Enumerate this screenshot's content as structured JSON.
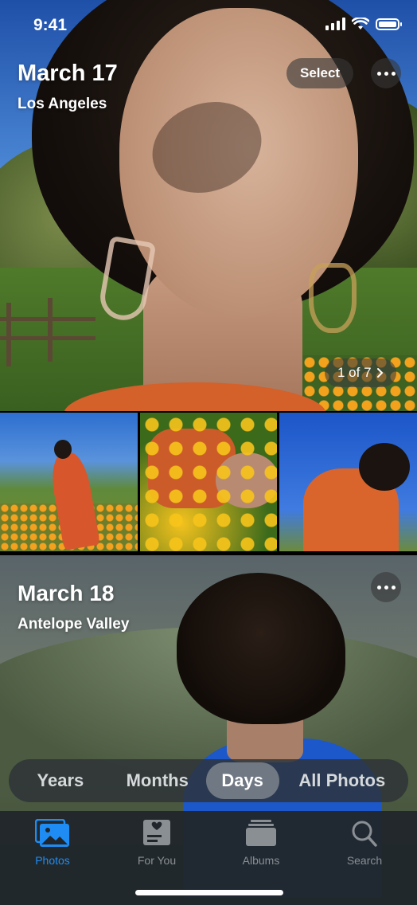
{
  "status_bar": {
    "time": "9:41"
  },
  "day1": {
    "date": "March 17",
    "location": "Los Angeles",
    "select_label": "Select",
    "pager_label": "1 of 7",
    "more_icon": "ellipsis-icon"
  },
  "day2": {
    "date": "March 18",
    "location": "Antelope Valley",
    "more_icon": "ellipsis-icon"
  },
  "segmented": {
    "options": [
      "Years",
      "Months",
      "Days",
      "All Photos"
    ],
    "selected": "Days"
  },
  "tabbar": {
    "accent_color": "#1f8cf3",
    "items": [
      {
        "label": "Photos",
        "icon": "photos-icon",
        "active": true
      },
      {
        "label": "For You",
        "icon": "for-you-icon",
        "active": false
      },
      {
        "label": "Albums",
        "icon": "albums-icon",
        "active": false
      },
      {
        "label": "Search",
        "icon": "search-icon",
        "active": false
      }
    ]
  }
}
